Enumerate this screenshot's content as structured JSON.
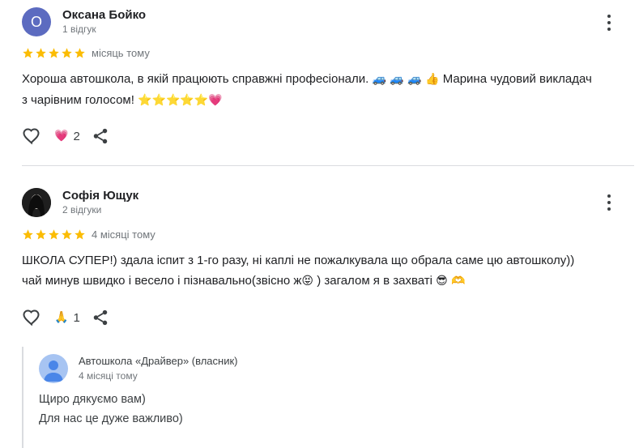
{
  "reviews": [
    {
      "avatar_letter": "О",
      "avatar_color": "#5c6bc0",
      "author": "Оксана Бойко",
      "review_count": "1 відгук",
      "rating": 5,
      "time": "місяць тому",
      "text_line1": "Хороша автошкола, в якій працюють справжні професіонали.",
      "text_line1_emoji": "🚙 🚙 🚙 👍",
      "text_line1_end": "Марина чудовий викладач",
      "text_line2": "з чарівним голосом!",
      "text_line2_emoji": "⭐⭐⭐⭐⭐💗",
      "reaction_emoji": "💗",
      "reaction_count": "2"
    },
    {
      "author": "Софія Ющук",
      "review_count": "2 відгуки",
      "rating": 5,
      "time": "4 місяці тому",
      "text_line1": "ШКОЛА СУПЕР!) здала іспит з 1-го разу, ні каплі не пожалкувала що обрала саме цю автошколу))",
      "text_line2_start": "чай минув швидко і весело і пізнавально(звісно ж",
      "text_line2_emoji1": "😝",
      "text_line2_mid": ") загалом я в захваті",
      "text_line2_emoji2": "😎 🫶",
      "reaction_emoji": "🙏",
      "reaction_count": "1",
      "owner_reply": {
        "owner_name": "Автошкола «Драйвер» (власник)",
        "time": "4 місяці тому",
        "line1": "Щиро дякуємо вам)",
        "line2": "Для нас це дуже важливо)"
      }
    }
  ],
  "colors": {
    "star": "#fbbc04",
    "divider": "#dadce0",
    "secondary_text": "#70757a"
  }
}
